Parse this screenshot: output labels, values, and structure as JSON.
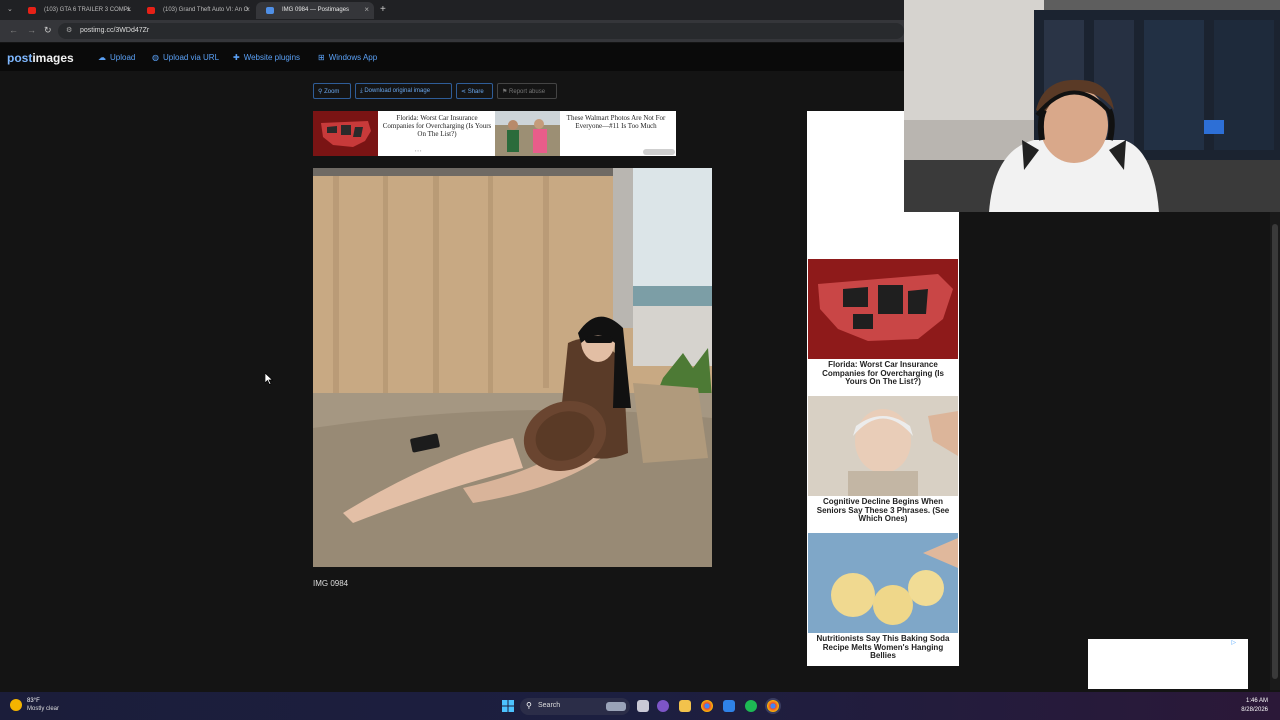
{
  "browser": {
    "tabs": [
      {
        "label": "(103) GTA 6 TRAILER 3 COMPL",
        "active": false
      },
      {
        "label": "(103) Grand Theft Auto VI: An O",
        "active": false
      },
      {
        "label": "IMG 0984 — Postimages",
        "active": true
      }
    ],
    "url": "postimg.cc/3WDd47Zr"
  },
  "site": {
    "logo_part1": "post",
    "logo_part2": "images",
    "nav": [
      "Upload",
      "Upload via URL",
      "Website plugins",
      "Windows App"
    ]
  },
  "toolbar": {
    "zoom": "Zoom",
    "download": "Download original image",
    "share": "Share",
    "report": "Report abuse"
  },
  "ads": {
    "banner": [
      {
        "text": "Florida: Worst Car Insurance Companies for Overcharging (Is Yours On The List?)"
      },
      {
        "text": "These Walmart Photos Are Not For Everyone—#11 Is Too Much"
      }
    ],
    "sidebar": [
      {
        "text": "Florida: Worst Car Insurance Companies for Overcharging (Is Yours On The List?)"
      },
      {
        "text": "Cognitive Decline Begins When Seniors Say These 3 Phrases. (See Which Ones)"
      },
      {
        "text": "Nutritionists Say This Baking Soda Recipe Melts Women's Hanging Bellies"
      }
    ]
  },
  "image": {
    "caption": "IMG 0984"
  },
  "taskbar": {
    "temperature": "83°F",
    "weather": "Mostly clear",
    "search": "Search",
    "time": "1:46 AM",
    "date": "8/28/2026"
  },
  "colors": {
    "accent": "#5aa0f5",
    "page_bg": "#141414"
  }
}
